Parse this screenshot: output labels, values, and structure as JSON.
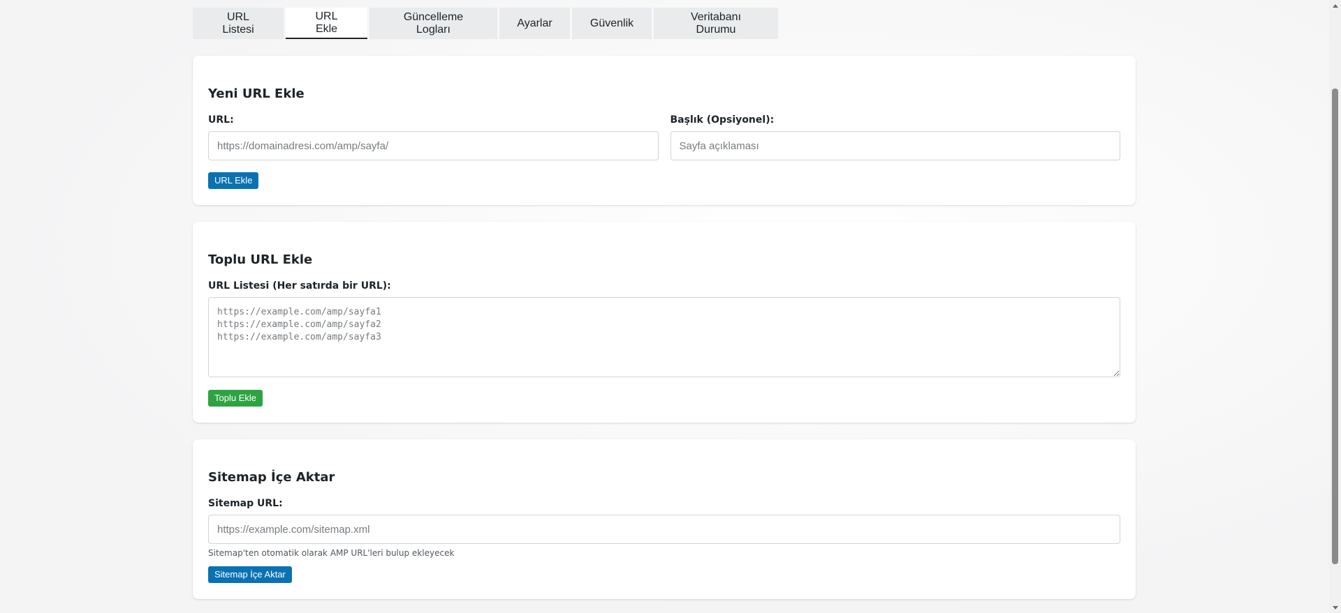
{
  "tabs": [
    {
      "label": "URL Listesi",
      "active": false
    },
    {
      "label": "URL Ekle",
      "active": true
    },
    {
      "label": "Güncelleme Logları",
      "active": false
    },
    {
      "label": "Ayarlar",
      "active": false
    },
    {
      "label": "Güvenlik",
      "active": false
    },
    {
      "label": "Veritabanı Durumu",
      "active": false
    }
  ],
  "add_url": {
    "title": "Yeni URL Ekle",
    "url_label": "URL:",
    "url_placeholder": "https://domainadresi.com/amp/sayfa/",
    "title_label": "Başlık (Opsiyonel):",
    "title_placeholder": "Sayfa açıklaması",
    "button_label": "URL Ekle"
  },
  "bulk_add": {
    "title": "Toplu URL Ekle",
    "list_label": "URL Listesi (Her satırda bir URL):",
    "list_placeholder": "https://example.com/amp/sayfa1\nhttps://example.com/amp/sayfa2\nhttps://example.com/amp/sayfa3",
    "button_label": "Toplu Ekle"
  },
  "sitemap": {
    "title": "Sitemap İçe Aktar",
    "url_label": "Sitemap URL:",
    "url_placeholder": "https://example.com/sitemap.xml",
    "help_text": "Sitemap'ten otomatik olarak AMP URL'leri bulup ekleyecek",
    "button_label": "Sitemap İçe Aktar"
  },
  "colors": {
    "primary_button": "#0a72b3",
    "success_button": "#2ea343",
    "tab_background": "#e9ebed"
  }
}
